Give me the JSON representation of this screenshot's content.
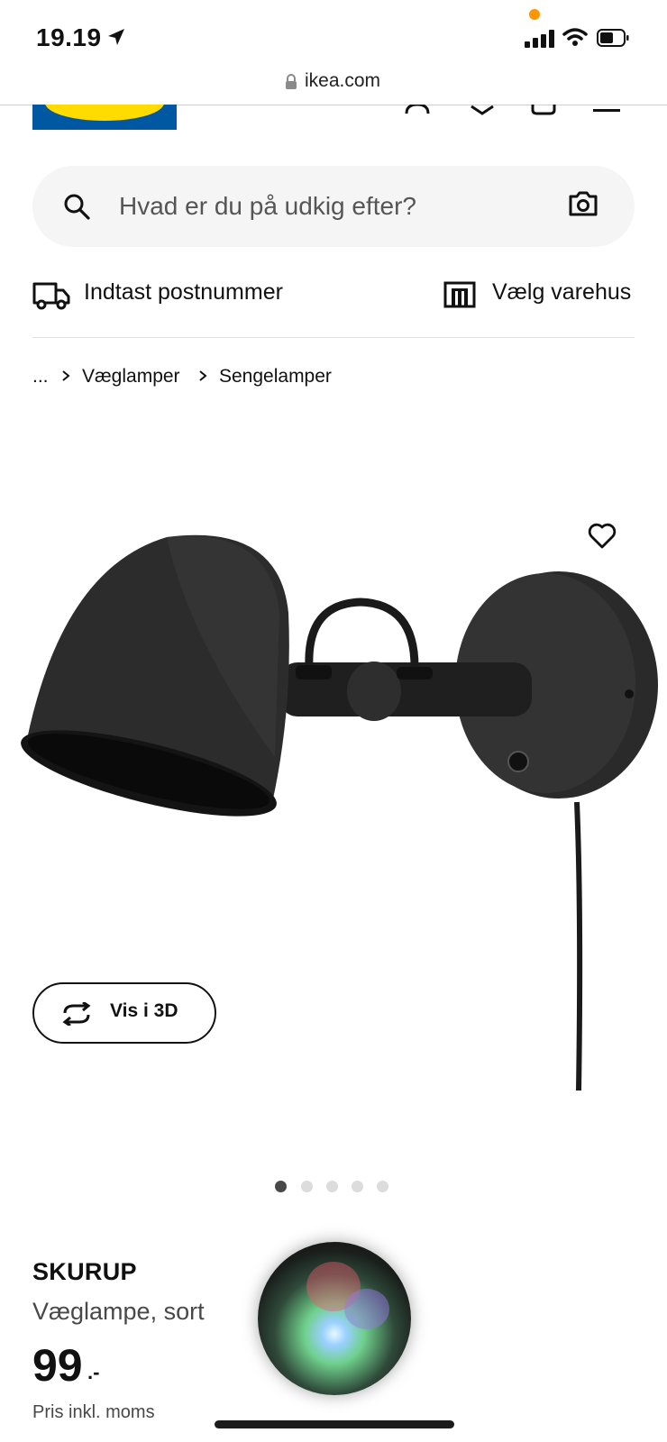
{
  "status_bar": {
    "time": "19.19"
  },
  "browser": {
    "url": "ikea.com"
  },
  "search": {
    "placeholder": "Hvad er du på udkig efter?"
  },
  "delivery": {
    "postal_label": "Indtast postnummer",
    "store_label": "Vælg varehus"
  },
  "breadcrumb": {
    "ellipsis": "...",
    "items": [
      "Væglamper",
      "Sengelamper"
    ]
  },
  "media": {
    "view_3d_label": "Vis i 3D",
    "image_count": 5,
    "active_index": 0
  },
  "product": {
    "name": "SKURUP",
    "description": "Væglampe, sort",
    "price": "99",
    "price_suffix": ".-",
    "vat_note": "Pris inkl. moms"
  },
  "colors": {
    "ikea_blue": "#0058a3",
    "ikea_yellow": "#ffdb00",
    "status_dot": "#ff9500"
  }
}
